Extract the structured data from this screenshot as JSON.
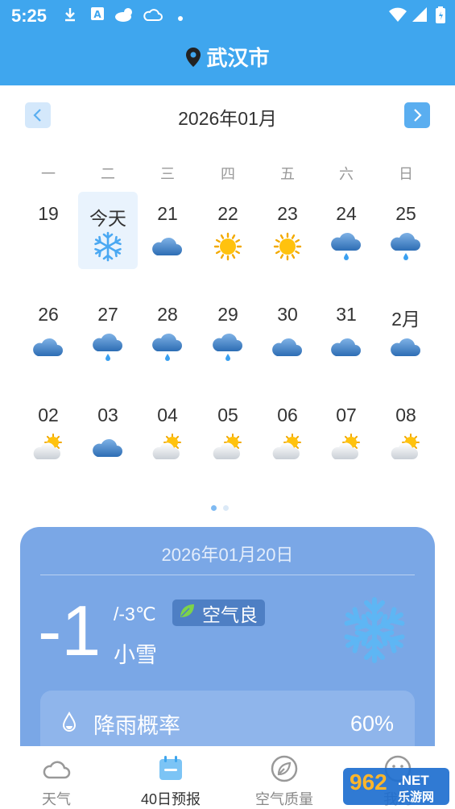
{
  "status_bar": {
    "time": "5:25"
  },
  "header": {
    "city": "武汉市"
  },
  "calendar": {
    "month_title": "2026年01月",
    "weekdays": [
      "一",
      "二",
      "三",
      "四",
      "五",
      "六",
      "日"
    ],
    "rows": [
      [
        {
          "label": "19",
          "icon": "none"
        },
        {
          "label": "今天",
          "icon": "snow",
          "today": true
        },
        {
          "label": "21",
          "icon": "cloud"
        },
        {
          "label": "22",
          "icon": "sun"
        },
        {
          "label": "23",
          "icon": "sun"
        },
        {
          "label": "24",
          "icon": "rain"
        },
        {
          "label": "25",
          "icon": "rain"
        }
      ],
      [
        {
          "label": "26",
          "icon": "cloud"
        },
        {
          "label": "27",
          "icon": "rain"
        },
        {
          "label": "28",
          "icon": "rain"
        },
        {
          "label": "29",
          "icon": "rain"
        },
        {
          "label": "30",
          "icon": "cloud"
        },
        {
          "label": "31",
          "icon": "cloud"
        },
        {
          "label": "2月",
          "icon": "cloud"
        }
      ],
      [
        {
          "label": "02",
          "icon": "partly"
        },
        {
          "label": "03",
          "icon": "cloud"
        },
        {
          "label": "04",
          "icon": "partly"
        },
        {
          "label": "05",
          "icon": "partly"
        },
        {
          "label": "06",
          "icon": "partly"
        },
        {
          "label": "07",
          "icon": "partly"
        },
        {
          "label": "08",
          "icon": "partly"
        }
      ]
    ]
  },
  "detail": {
    "date": "2026年01月20日",
    "temp": "-1",
    "range": "/-3℃",
    "air_quality": "空气良",
    "condition": "小雪",
    "rain_label": "降雨概率",
    "rain_value": "60%"
  },
  "tabs": [
    {
      "label": "天气",
      "icon": "cloud-outline-icon"
    },
    {
      "label": "40日预报",
      "icon": "calendar-icon",
      "active": true
    },
    {
      "label": "空气质量",
      "icon": "leaf-outline-icon"
    },
    {
      "label": "我的",
      "icon": "smiley-icon"
    }
  ],
  "watermark": {
    "line1": "962",
    "line2": ".NET",
    "line3": "乐游网"
  },
  "colors": {
    "header": "#3fa6ee",
    "card": "#7aa7e6",
    "accent": "#5aaef0"
  }
}
